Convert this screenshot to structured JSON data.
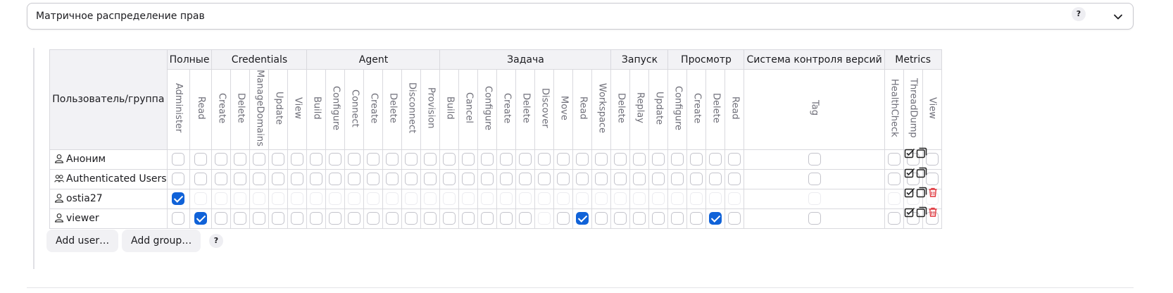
{
  "strategy_select": {
    "value": "Матричное распределение прав"
  },
  "help_label": "?",
  "table": {
    "user_header": "Пользователь/группа",
    "groups": [
      {
        "name": "Полные",
        "perms": [
          "Administer",
          "Read"
        ]
      },
      {
        "name": "Credentials",
        "perms": [
          "Create",
          "Delete",
          "ManageDomains",
          "Update",
          "View"
        ]
      },
      {
        "name": "Agent",
        "perms": [
          "Build",
          "Configure",
          "Connect",
          "Create",
          "Delete",
          "Disconnect",
          "Provision"
        ]
      },
      {
        "name": "Задача",
        "perms": [
          "Build",
          "Cancel",
          "Configure",
          "Create",
          "Delete",
          "Discover",
          "Move",
          "Read",
          "Workspace"
        ]
      },
      {
        "name": "Запуск",
        "perms": [
          "Delete",
          "Replay",
          "Update"
        ]
      },
      {
        "name": "Просмотр",
        "perms": [
          "Configure",
          "Create",
          "Delete",
          "Read"
        ]
      },
      {
        "name": "Система контроля версий",
        "perms": [
          "Tag"
        ]
      },
      {
        "name": "Metrics",
        "perms": [
          "HealthCheck",
          "ThreadDump",
          "View"
        ]
      }
    ],
    "rows": [
      {
        "name": "Аноним",
        "icon": "user-icon",
        "deletable": false,
        "checked": [],
        "dimmed": []
      },
      {
        "name": "Authenticated Users",
        "icon": "group-icon",
        "deletable": false,
        "checked": [],
        "dimmed": []
      },
      {
        "name": "ostia27",
        "icon": "user-icon",
        "deletable": true,
        "checked": [
          0
        ],
        "dimmed": [
          1,
          2,
          3,
          4,
          5,
          6,
          7,
          8,
          9,
          10,
          11,
          12,
          13,
          14,
          15,
          16,
          17,
          18,
          19,
          20,
          21,
          22,
          23,
          24,
          25,
          26,
          27,
          28,
          29,
          30,
          31,
          32,
          33,
          34
        ]
      },
      {
        "name": "viewer",
        "icon": "user-icon",
        "deletable": true,
        "checked": [
          1,
          21,
          28
        ],
        "dimmed": [
          19
        ]
      }
    ]
  },
  "buttons": {
    "add_user": "Add user…",
    "add_group": "Add group…"
  },
  "colors": {
    "accent": "#1062d8",
    "delete": "#e0343b"
  }
}
